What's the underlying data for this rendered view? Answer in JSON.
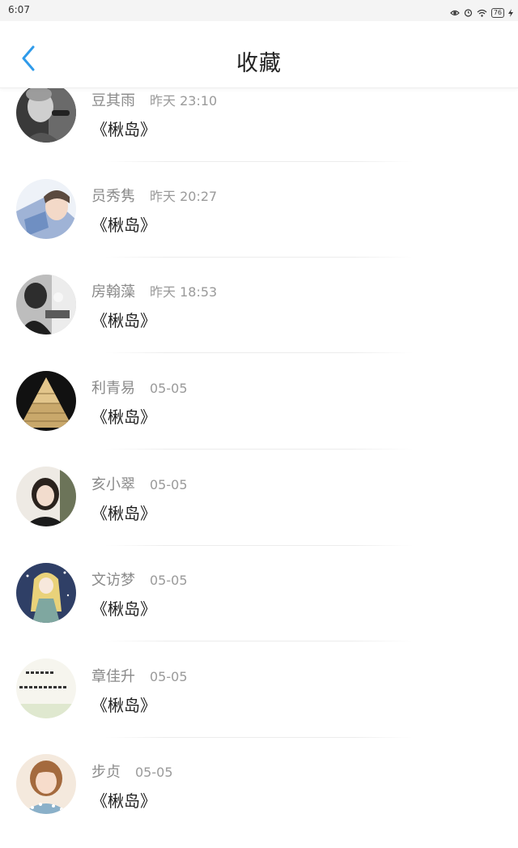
{
  "status_bar": {
    "time": "6:07",
    "battery": "76"
  },
  "header": {
    "title": "收藏"
  },
  "favorites": [
    {
      "name": "豆其雨",
      "time": "昨天 23:10",
      "book": "《楸岛》",
      "avatar": "photo-grayscale-man"
    },
    {
      "name": "员秀隽",
      "time": "昨天 20:27",
      "book": "《楸岛》",
      "avatar": "photo-anime-boy"
    },
    {
      "name": "房翰藻",
      "time": "昨天 18:53",
      "book": "《楸岛》",
      "avatar": "photo-bw-people"
    },
    {
      "name": "利青易",
      "time": "05-05",
      "book": "《楸岛》",
      "avatar": "photo-gold-pyramid"
    },
    {
      "name": "亥小翠",
      "time": "05-05",
      "book": "《楸岛》",
      "avatar": "photo-girl-portrait"
    },
    {
      "name": "文访梦",
      "time": "05-05",
      "book": "《楸岛》",
      "avatar": "illustration-blonde-girl"
    },
    {
      "name": "章佳升",
      "time": "05-05",
      "book": "《楸岛》",
      "avatar": "calligraphy-text-image"
    },
    {
      "name": "步贞",
      "time": "05-05",
      "book": "《楸岛》",
      "avatar": "photo-girl-flowers"
    }
  ]
}
